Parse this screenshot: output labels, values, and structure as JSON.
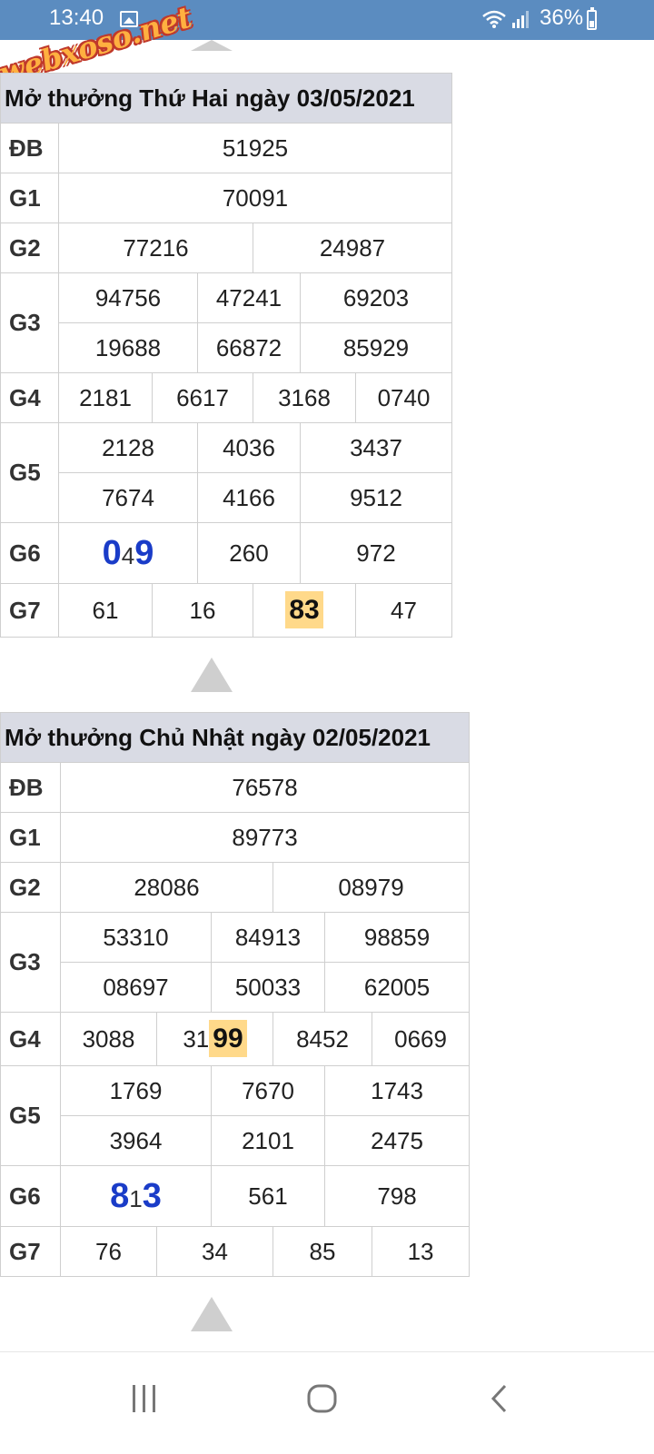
{
  "status_bar": {
    "time": "13:40",
    "battery": "36%"
  },
  "watermark": "webxoso.net",
  "boards": [
    {
      "caption": "Mở thưởng Thứ Hai ngày 03/05/2021",
      "db": "51925",
      "g1": "70091",
      "g2": [
        "77216",
        "24987"
      ],
      "g3": [
        "94756",
        "47241",
        "69203",
        "19688",
        "66872",
        "85929"
      ],
      "g4": [
        "2181",
        "6617",
        "3168",
        "0740"
      ],
      "g5": [
        "2128",
        "4036",
        "3437",
        "7674",
        "4166",
        "9512"
      ],
      "g6_first": {
        "a": "0",
        "b": "4",
        "c": "9"
      },
      "g6": [
        "260",
        "972"
      ],
      "g7": [
        "61",
        "16",
        "83",
        "47"
      ]
    },
    {
      "caption": "Mở thưởng Chủ Nhật ngày 02/05/2021",
      "db": "76578",
      "g1": "89773",
      "g2": [
        "28086",
        "08979"
      ],
      "g3": [
        "53310",
        "84913",
        "98859",
        "08697",
        "50033",
        "62005"
      ],
      "g4": [
        "3088",
        "8452",
        "0669"
      ],
      "g4_split": {
        "prefix": "31",
        "highlight": "99"
      },
      "g5": [
        "1769",
        "7670",
        "1743",
        "3964",
        "2101",
        "2475"
      ],
      "g6_first": {
        "a": "8",
        "b": "1",
        "c": "3"
      },
      "g6": [
        "561",
        "798"
      ],
      "g7": [
        "76",
        "34",
        "85",
        "13"
      ]
    }
  ],
  "labels": {
    "db": "ĐB",
    "g1": "G1",
    "g2": "G2",
    "g3": "G3",
    "g4": "G4",
    "g5": "G5",
    "g6": "G6",
    "g7": "G7"
  },
  "icons": {
    "wifi": "wifi-icon",
    "signal": "signal-icon",
    "battery": "battery-icon",
    "image": "image-icon",
    "recents": "recents-icon",
    "home": "home-icon",
    "back": "back-icon",
    "scroll_up": "triangle-up-icon"
  }
}
